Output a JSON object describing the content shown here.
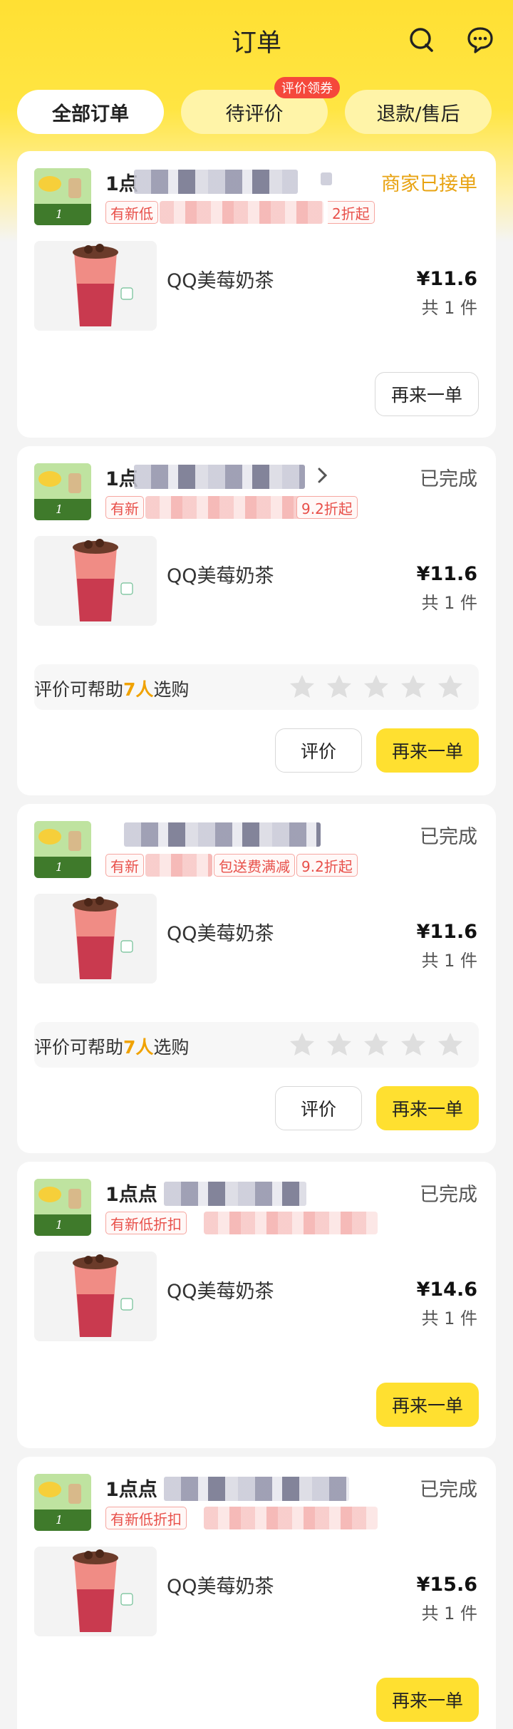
{
  "header": {
    "title": "订单",
    "search_icon": "search-icon",
    "message_icon": "chat-icon"
  },
  "tabs": [
    {
      "label": "全部订单",
      "active": true
    },
    {
      "label": "待评价",
      "badge": "评价领券"
    },
    {
      "label": "退款/售后"
    }
  ],
  "orders": [
    {
      "shop": "1点",
      "status": "商家已接单",
      "promo_first": "有新低",
      "promo_last": "2折起",
      "product": "QQ美莓奶茶",
      "price": "¥11.6",
      "qty": "共 1 件",
      "reorder": "再来一单"
    },
    {
      "shop": "1点",
      "status": "已完成",
      "promo_first": "有新",
      "promo_last": "9.2折起",
      "product": "QQ美莓奶茶",
      "price": "¥11.6",
      "qty": "共 1 件",
      "review_prefix": "评价可帮助",
      "review_count": "7人",
      "review_suffix": "选购",
      "review_btn": "评价",
      "reorder": "再来一单"
    },
    {
      "shop": "",
      "status": "已完成",
      "promo_first": "有新",
      "promo_mid": "包送费满减",
      "promo_last": "9.2折起",
      "product": "QQ美莓奶茶",
      "price": "¥11.6",
      "qty": "共 1 件",
      "review_prefix": "评价可帮助",
      "review_count": "7人",
      "review_suffix": "选购",
      "review_btn": "评价",
      "reorder": "再来一单"
    },
    {
      "shop": "1点点",
      "status": "已完成",
      "promo_first": "有新低折扣",
      "product": "QQ美莓奶茶",
      "price": "¥14.6",
      "qty": "共 1 件",
      "reorder": "再来一单"
    },
    {
      "shop": "1点点",
      "status": "已完成",
      "promo_first": "有新低折扣",
      "product": "QQ美莓奶茶",
      "price": "¥15.6",
      "qty": "共 1 件",
      "reorder": "再来一单"
    }
  ],
  "colors": {
    "brand_yellow": "#ffe030",
    "accent_orange": "#e8a312",
    "promo_red": "#e8504a"
  }
}
